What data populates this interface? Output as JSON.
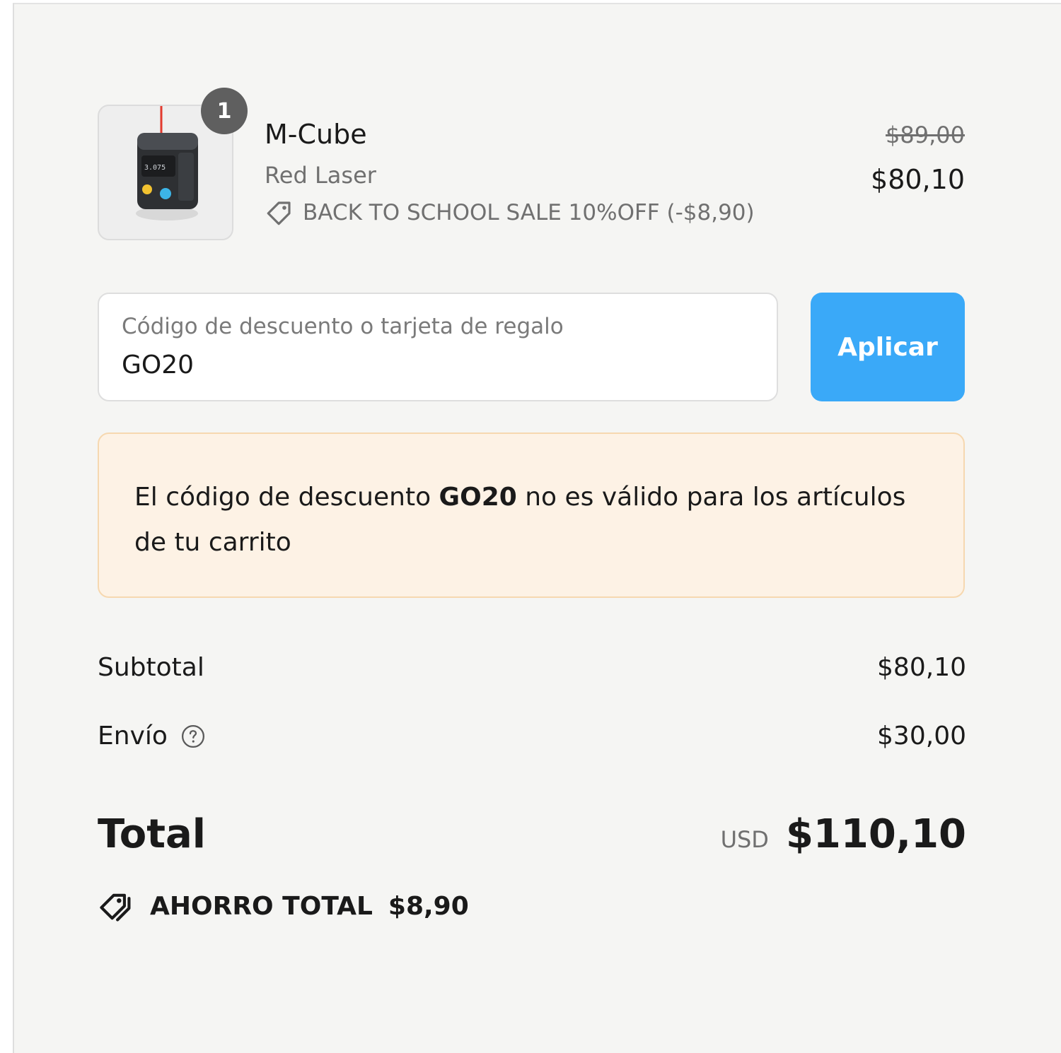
{
  "cart_item": {
    "quantity": "1",
    "name": "M-Cube",
    "variant": "Red Laser",
    "discount_text": "BACK TO SCHOOL SALE 10%OFF (-$8,90)",
    "original_price": "$89,00",
    "final_price": "$80,10",
    "thumbnail_icon": "laser-level-device-image"
  },
  "discount_code": {
    "label": "Código de descuento o tarjeta de regalo",
    "value": "GO20",
    "apply_label": "Aplicar"
  },
  "alert": {
    "prefix": "El código de descuento ",
    "code": "GO20",
    "suffix": " no es válido para los artículos de tu carrito"
  },
  "summary": {
    "subtotal_label": "Subtotal",
    "subtotal_value": "$80,10",
    "shipping_label": "Envío",
    "shipping_value": "$30,00",
    "total_label": "Total",
    "currency": "USD",
    "total_value": "$110,10",
    "savings_label": "AHORRO TOTAL",
    "savings_value": "$8,90"
  },
  "colors": {
    "panel_background": "#f5f5f3",
    "apply_button": "#3aa9f8",
    "alert_background": "#fdf2e5",
    "alert_border": "#f6d8b0",
    "badge": "#5f5f5f"
  }
}
